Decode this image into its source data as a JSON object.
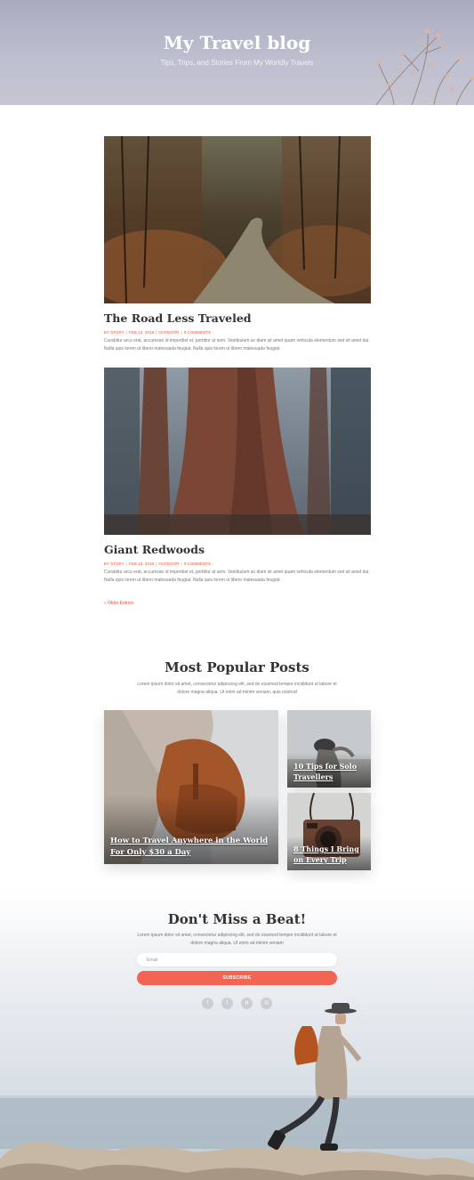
{
  "header": {
    "title": "My Travel blog",
    "subtitle": "Tips, Trips, and Stories From My Worldly Travels"
  },
  "posts": [
    {
      "title": "The Road Less Traveled",
      "meta": {
        "author": "BY STORY",
        "date": "FEB 13, 2018",
        "category": "OUTDOOR",
        "comments": "0 COMMENTS"
      },
      "excerpt": "Curabitur arcu erat, accumsan id imperdiet et, porttitor at sem. Vestibulum ac diam sit amet quam vehicula elementum sed sit amet dui. Nulla quis lorem ut libero malesuada feugiat. Nulla quis lorem ut libero malesuada feugiat."
    },
    {
      "title": "Giant Redwoods",
      "meta": {
        "author": "BY STORY",
        "date": "FEB 13, 2018",
        "category": "OUTDOOR",
        "comments": "0 COMMENTS"
      },
      "excerpt": "Curabitur arcu erat, accumsan id imperdiet et, porttitor at sem. Vestibulum ac diam sit amet quam vehicula elementum sed sit amet dui. Nulla quis lorem ut libero malesuada feugiat. Nulla quis lorem ut libero malesuada feugiat."
    }
  ],
  "pagination": {
    "older_label": "« Older Entries"
  },
  "popular": {
    "title": "Most Popular Posts",
    "description": "Lorem ipsum dolor sit amet, consectetur adipiscing elit, sed do eiusmod tempor incididunt ut labore et dolore magna aliqua. Ut enim ad minim veniam, quis nostrud",
    "cards": [
      {
        "label": "How to Travel Anywhere in the World For Only $30 a Day"
      },
      {
        "label": "10 Tips for Solo Travellers"
      },
      {
        "label": "8 Things I Bring on Every Trip"
      }
    ]
  },
  "newsletter": {
    "title": "Don't Miss a Beat!",
    "description": "Lorem ipsum dolor sit amet, consectetur adipiscing elit, sed do eiusmod tempor incididunt ut labore et dolore magna aliqua. Ut enim ad minim veniam",
    "email_placeholder": "Email",
    "subscribe_label": "SUBSCRIBE",
    "social": [
      "facebook-icon",
      "twitter-icon",
      "pinterest-icon",
      "instagram-icon"
    ]
  },
  "colors": {
    "accent": "#f26552",
    "meta_red": "#e0533d",
    "heading": "#333333"
  }
}
